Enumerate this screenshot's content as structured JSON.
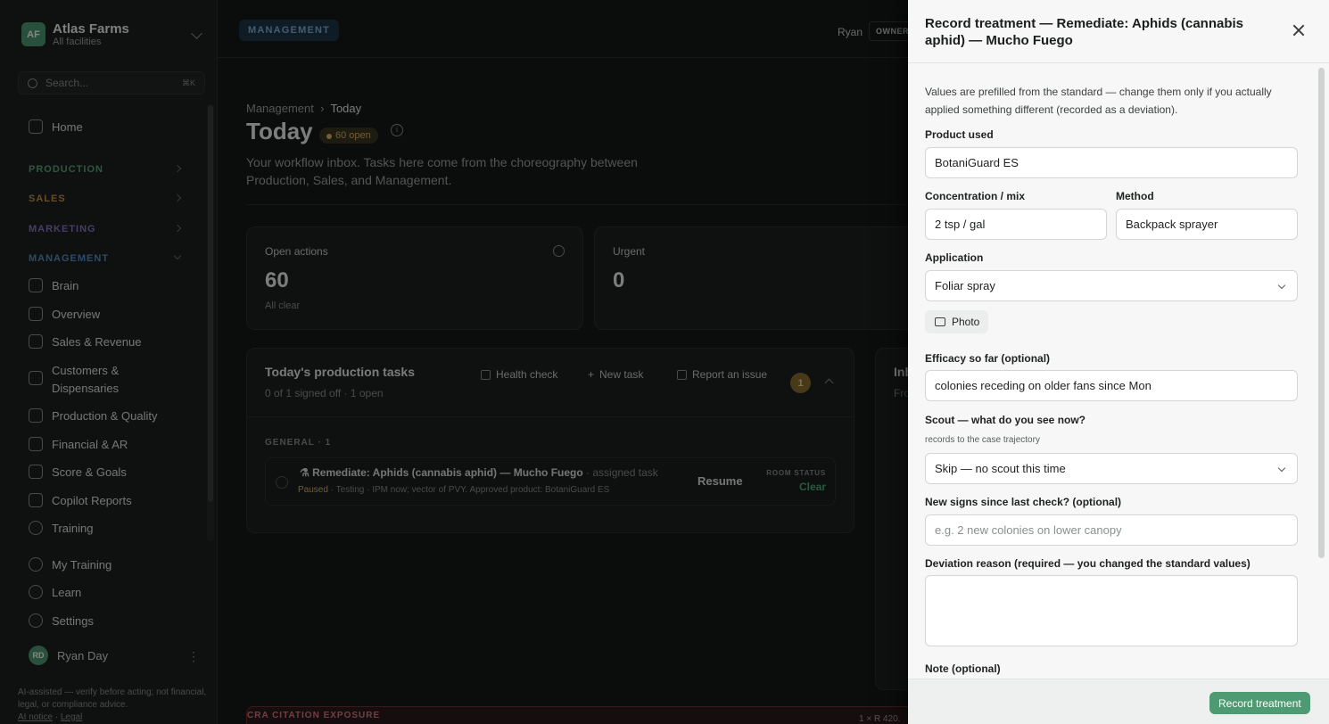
{
  "org": {
    "initials": "AF",
    "name": "Atlas Farms",
    "sub": "All facilities"
  },
  "search": {
    "placeholder": "Search...",
    "shortcut": "⌘K"
  },
  "nav": {
    "home": "Home",
    "sections": {
      "production": "PRODUCTION",
      "sales": "SALES",
      "marketing": "MARKETING",
      "management": "MANAGEMENT"
    },
    "items": [
      "Brain",
      "Overview",
      "Sales & Revenue",
      "Customers & Dispensaries",
      "Production & Quality",
      "Financial & AR",
      "Score & Goals",
      "Copilot Reports",
      "Training"
    ],
    "bottom": [
      "My Training",
      "Learn",
      "Settings"
    ]
  },
  "user": {
    "initials": "RD",
    "name": "Ryan Day"
  },
  "footer": {
    "text": "AI-assisted — verify before acting; not financial, legal, or compliance advice.",
    "ai_notice": "AI notice",
    "sep": "·",
    "legal": "Legal"
  },
  "header": {
    "pill": "MANAGEMENT",
    "user": "Ryan",
    "role": "OWNER"
  },
  "page": {
    "crumb_parent": "Management",
    "crumb_current": "Today",
    "title": "Today",
    "badge": "60 open",
    "description": "Your workflow inbox. Tasks here come from the choreography between Production, Sales, and Management."
  },
  "cards": {
    "open": {
      "label": "Open actions",
      "value": "60",
      "sub": "All clear"
    },
    "urgent": {
      "label": "Urgent",
      "value": "0"
    }
  },
  "tasks": {
    "title": "Today's production tasks",
    "sub": "0 of 1 signed off · 1 open",
    "health_check": "Health check",
    "new_task": "New task",
    "report": "Report an issue",
    "count": "1",
    "group": "GENERAL · 1",
    "row": {
      "name": "Remediate: Aphids (cannabis aphid) — Mucho Fuego",
      "assigned": "· assigned task",
      "status": "Paused",
      "meta": "· Testing · IPM now; vector of PVY. Approved product: BotaniGuard ES",
      "resume": "Resume",
      "room_status_label": "ROOM STATUS",
      "room_status_value": "Clear"
    }
  },
  "side_card": {
    "title": "Inb",
    "sub": "Fro"
  },
  "cra": {
    "label": "CRA CITATION EXPOSURE",
    "amount": "1 × R 420."
  },
  "panel": {
    "title": "Record treatment — Remediate: Aphids (cannabis aphid) — Mucho Fuego",
    "intro": "Values are prefilled from the standard — change them only if you actually applied something different (recorded as a deviation).",
    "product_label": "Product used",
    "product_value": "BotaniGuard ES",
    "conc_label": "Concentration / mix",
    "conc_value": "2 tsp / gal",
    "method_label": "Method",
    "method_value": "Backpack sprayer",
    "application_label": "Application",
    "application_value": "Foliar spray",
    "photo": "Photo",
    "efficacy_label": "Efficacy so far (optional)",
    "efficacy_value": "colonies receding on older fans since Mon",
    "scout_label": "Scout — what do you see now?",
    "scout_hint": "records to the case trajectory",
    "scout_value": "Skip — no scout this time",
    "signs_label": "New signs since last check? (optional)",
    "signs_placeholder": "e.g. 2 new colonies on lower canopy",
    "deviation_label": "Deviation reason (required — you changed the standard values)",
    "note_label": "Note (optional)",
    "submit": "Record treatment"
  }
}
